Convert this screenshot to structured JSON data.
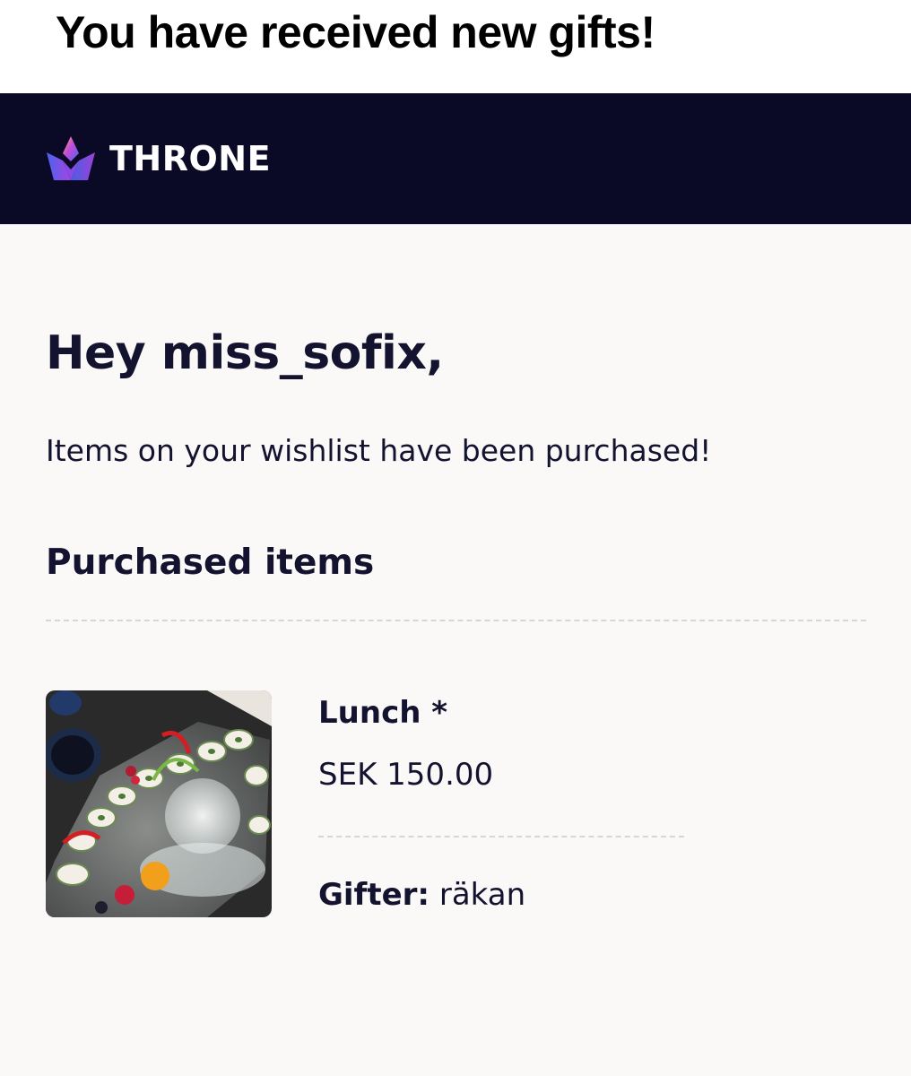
{
  "caption": {
    "text": "You have received new gifts!"
  },
  "header": {
    "brand_name": "THRONE",
    "logo_icon": "crown-icon",
    "background_color": "#0b0a26"
  },
  "email": {
    "greeting": "Hey miss_sofix,",
    "intro": "Items on your wishlist have been purchased!",
    "section_title": "Purchased items",
    "items": [
      {
        "name": "Lunch *",
        "price": "SEK 150.00",
        "gifter_label": "Gifter:",
        "gifter_name": "räkan",
        "image_icon": "sushi-platter-image"
      }
    ]
  },
  "colors": {
    "text": "#14132f",
    "body_background": "#faf9f8",
    "divider": "#d6d6d8"
  }
}
